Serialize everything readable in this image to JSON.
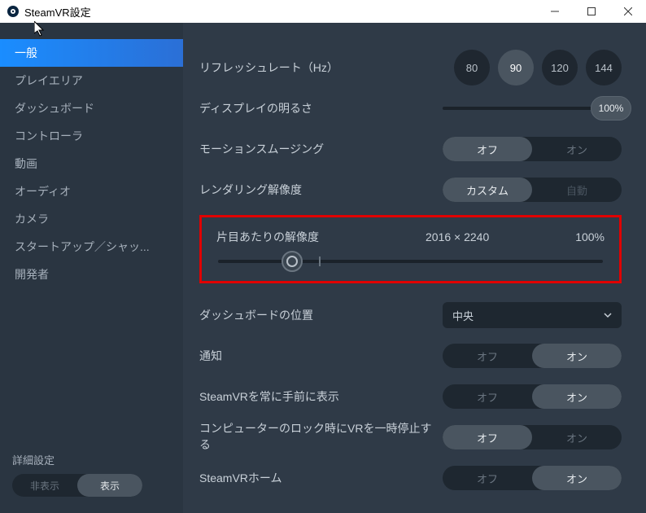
{
  "window": {
    "title": "SteamVR設定"
  },
  "sidebar": {
    "items": [
      "一般",
      "プレイエリア",
      "ダッシュボード",
      "コントローラ",
      "動画",
      "オーディオ",
      "カメラ",
      "スタートアップ／シャッ...",
      "開発者"
    ],
    "footer_label": "詳細設定",
    "footer_hide": "非表示",
    "footer_show": "表示"
  },
  "settings": {
    "refresh": {
      "label": "リフレッシュレート（Hz）",
      "options": [
        "80",
        "90",
        "120",
        "144"
      ],
      "active": "90"
    },
    "brightness": {
      "label": "ディスプレイの明るさ",
      "value": "100%"
    },
    "motion": {
      "label": "モーションスムージング",
      "off": "オフ",
      "on": "オン"
    },
    "render": {
      "label": "レンダリング解像度",
      "custom": "カスタム",
      "auto": "自動"
    },
    "pereye": {
      "label": "片目あたりの解像度",
      "resolution": "2016 × 2240",
      "percent": "100%"
    },
    "dashpos": {
      "label": "ダッシュボードの位置",
      "value": "中央"
    },
    "notify": {
      "label": "通知",
      "off": "オフ",
      "on": "オン"
    },
    "alwaysfront": {
      "label": "SteamVRを常に手前に表示",
      "off": "オフ",
      "on": "オン"
    },
    "locksuspend": {
      "label": "コンピューターのロック時にVRを一時停止する",
      "off": "オフ",
      "on": "オン"
    },
    "vrhome": {
      "label": "SteamVRホーム",
      "off": "オフ",
      "on": "オン"
    }
  }
}
